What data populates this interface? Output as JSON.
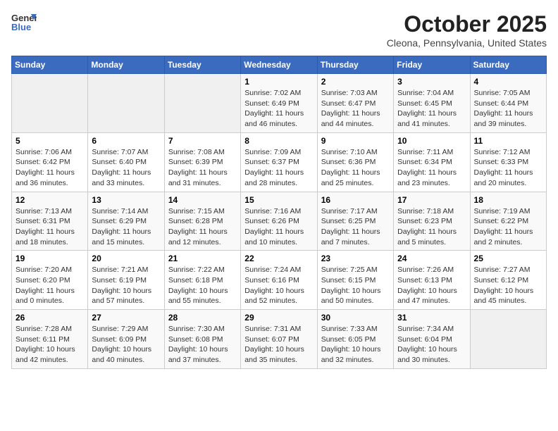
{
  "header": {
    "logo_line1": "General",
    "logo_line2": "Blue",
    "month": "October 2025",
    "location": "Cleona, Pennsylvania, United States"
  },
  "weekdays": [
    "Sunday",
    "Monday",
    "Tuesday",
    "Wednesday",
    "Thursday",
    "Friday",
    "Saturday"
  ],
  "weeks": [
    [
      {
        "day": "",
        "sunrise": "",
        "sunset": "",
        "daylight": ""
      },
      {
        "day": "",
        "sunrise": "",
        "sunset": "",
        "daylight": ""
      },
      {
        "day": "",
        "sunrise": "",
        "sunset": "",
        "daylight": ""
      },
      {
        "day": "1",
        "sunrise": "Sunrise: 7:02 AM",
        "sunset": "Sunset: 6:49 PM",
        "daylight": "Daylight: 11 hours and 46 minutes."
      },
      {
        "day": "2",
        "sunrise": "Sunrise: 7:03 AM",
        "sunset": "Sunset: 6:47 PM",
        "daylight": "Daylight: 11 hours and 44 minutes."
      },
      {
        "day": "3",
        "sunrise": "Sunrise: 7:04 AM",
        "sunset": "Sunset: 6:45 PM",
        "daylight": "Daylight: 11 hours and 41 minutes."
      },
      {
        "day": "4",
        "sunrise": "Sunrise: 7:05 AM",
        "sunset": "Sunset: 6:44 PM",
        "daylight": "Daylight: 11 hours and 39 minutes."
      }
    ],
    [
      {
        "day": "5",
        "sunrise": "Sunrise: 7:06 AM",
        "sunset": "Sunset: 6:42 PM",
        "daylight": "Daylight: 11 hours and 36 minutes."
      },
      {
        "day": "6",
        "sunrise": "Sunrise: 7:07 AM",
        "sunset": "Sunset: 6:40 PM",
        "daylight": "Daylight: 11 hours and 33 minutes."
      },
      {
        "day": "7",
        "sunrise": "Sunrise: 7:08 AM",
        "sunset": "Sunset: 6:39 PM",
        "daylight": "Daylight: 11 hours and 31 minutes."
      },
      {
        "day": "8",
        "sunrise": "Sunrise: 7:09 AM",
        "sunset": "Sunset: 6:37 PM",
        "daylight": "Daylight: 11 hours and 28 minutes."
      },
      {
        "day": "9",
        "sunrise": "Sunrise: 7:10 AM",
        "sunset": "Sunset: 6:36 PM",
        "daylight": "Daylight: 11 hours and 25 minutes."
      },
      {
        "day": "10",
        "sunrise": "Sunrise: 7:11 AM",
        "sunset": "Sunset: 6:34 PM",
        "daylight": "Daylight: 11 hours and 23 minutes."
      },
      {
        "day": "11",
        "sunrise": "Sunrise: 7:12 AM",
        "sunset": "Sunset: 6:33 PM",
        "daylight": "Daylight: 11 hours and 20 minutes."
      }
    ],
    [
      {
        "day": "12",
        "sunrise": "Sunrise: 7:13 AM",
        "sunset": "Sunset: 6:31 PM",
        "daylight": "Daylight: 11 hours and 18 minutes."
      },
      {
        "day": "13",
        "sunrise": "Sunrise: 7:14 AM",
        "sunset": "Sunset: 6:29 PM",
        "daylight": "Daylight: 11 hours and 15 minutes."
      },
      {
        "day": "14",
        "sunrise": "Sunrise: 7:15 AM",
        "sunset": "Sunset: 6:28 PM",
        "daylight": "Daylight: 11 hours and 12 minutes."
      },
      {
        "day": "15",
        "sunrise": "Sunrise: 7:16 AM",
        "sunset": "Sunset: 6:26 PM",
        "daylight": "Daylight: 11 hours and 10 minutes."
      },
      {
        "day": "16",
        "sunrise": "Sunrise: 7:17 AM",
        "sunset": "Sunset: 6:25 PM",
        "daylight": "Daylight: 11 hours and 7 minutes."
      },
      {
        "day": "17",
        "sunrise": "Sunrise: 7:18 AM",
        "sunset": "Sunset: 6:23 PM",
        "daylight": "Daylight: 11 hours and 5 minutes."
      },
      {
        "day": "18",
        "sunrise": "Sunrise: 7:19 AM",
        "sunset": "Sunset: 6:22 PM",
        "daylight": "Daylight: 11 hours and 2 minutes."
      }
    ],
    [
      {
        "day": "19",
        "sunrise": "Sunrise: 7:20 AM",
        "sunset": "Sunset: 6:20 PM",
        "daylight": "Daylight: 11 hours and 0 minutes."
      },
      {
        "day": "20",
        "sunrise": "Sunrise: 7:21 AM",
        "sunset": "Sunset: 6:19 PM",
        "daylight": "Daylight: 10 hours and 57 minutes."
      },
      {
        "day": "21",
        "sunrise": "Sunrise: 7:22 AM",
        "sunset": "Sunset: 6:18 PM",
        "daylight": "Daylight: 10 hours and 55 minutes."
      },
      {
        "day": "22",
        "sunrise": "Sunrise: 7:24 AM",
        "sunset": "Sunset: 6:16 PM",
        "daylight": "Daylight: 10 hours and 52 minutes."
      },
      {
        "day": "23",
        "sunrise": "Sunrise: 7:25 AM",
        "sunset": "Sunset: 6:15 PM",
        "daylight": "Daylight: 10 hours and 50 minutes."
      },
      {
        "day": "24",
        "sunrise": "Sunrise: 7:26 AM",
        "sunset": "Sunset: 6:13 PM",
        "daylight": "Daylight: 10 hours and 47 minutes."
      },
      {
        "day": "25",
        "sunrise": "Sunrise: 7:27 AM",
        "sunset": "Sunset: 6:12 PM",
        "daylight": "Daylight: 10 hours and 45 minutes."
      }
    ],
    [
      {
        "day": "26",
        "sunrise": "Sunrise: 7:28 AM",
        "sunset": "Sunset: 6:11 PM",
        "daylight": "Daylight: 10 hours and 42 minutes."
      },
      {
        "day": "27",
        "sunrise": "Sunrise: 7:29 AM",
        "sunset": "Sunset: 6:09 PM",
        "daylight": "Daylight: 10 hours and 40 minutes."
      },
      {
        "day": "28",
        "sunrise": "Sunrise: 7:30 AM",
        "sunset": "Sunset: 6:08 PM",
        "daylight": "Daylight: 10 hours and 37 minutes."
      },
      {
        "day": "29",
        "sunrise": "Sunrise: 7:31 AM",
        "sunset": "Sunset: 6:07 PM",
        "daylight": "Daylight: 10 hours and 35 minutes."
      },
      {
        "day": "30",
        "sunrise": "Sunrise: 7:33 AM",
        "sunset": "Sunset: 6:05 PM",
        "daylight": "Daylight: 10 hours and 32 minutes."
      },
      {
        "day": "31",
        "sunrise": "Sunrise: 7:34 AM",
        "sunset": "Sunset: 6:04 PM",
        "daylight": "Daylight: 10 hours and 30 minutes."
      },
      {
        "day": "",
        "sunrise": "",
        "sunset": "",
        "daylight": ""
      }
    ]
  ]
}
